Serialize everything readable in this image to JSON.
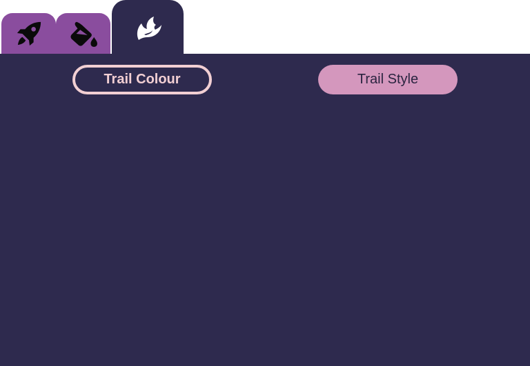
{
  "tabs": [
    {
      "icon": "rocket-icon",
      "active": false,
      "color": "#8a4d9e"
    },
    {
      "icon": "paint-bucket-icon",
      "active": false,
      "color": "#8a4d9e"
    },
    {
      "icon": "trail-flame-icon",
      "active": true,
      "color": "#2e2a4e"
    }
  ],
  "panel": {
    "background": "#2e2a4e",
    "buttons": {
      "trail_colour_label": "Trail Colour",
      "trail_style_label": "Trail Style"
    }
  },
  "colors": {
    "tab_inactive": "#8a4d9e",
    "tab_active": "#2e2a4e",
    "colour_button_outline": "#f2cfd3",
    "style_button_fill": "#d497bd"
  }
}
